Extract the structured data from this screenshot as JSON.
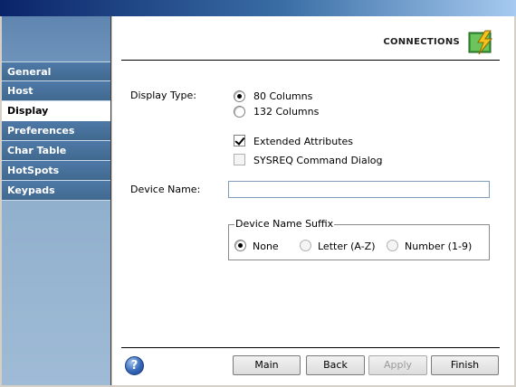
{
  "header": {
    "title": "CONNECTIONS",
    "icon": "connections-lightning-icon"
  },
  "sidebar": {
    "items": [
      {
        "label": "General"
      },
      {
        "label": "Host"
      },
      {
        "label": "Display"
      },
      {
        "label": "Preferences"
      },
      {
        "label": "Char Table"
      },
      {
        "label": "HotSpots"
      },
      {
        "label": "Keypads"
      }
    ],
    "active": "Display"
  },
  "display_type": {
    "label": "Display Type:",
    "options": [
      {
        "label": "80 Columns",
        "selected": true
      },
      {
        "label": "132 Columns",
        "selected": false
      }
    ]
  },
  "checkboxes": {
    "extended_attributes": {
      "label": "Extended Attributes",
      "checked": true
    },
    "sysreq_dialog": {
      "label": "SYSREQ Command Dialog",
      "checked": false
    }
  },
  "device_name": {
    "label": "Device Name:",
    "value": ""
  },
  "suffix": {
    "legend": "Device Name Suffix",
    "options": [
      {
        "label": "None",
        "selected": true
      },
      {
        "label": "Letter (A-Z)",
        "selected": false
      },
      {
        "label": "Number (1-9)",
        "selected": false
      }
    ]
  },
  "buttons": {
    "main": "Main",
    "back": "Back",
    "apply": "Apply",
    "finish": "Finish"
  },
  "colors": {
    "sidebar_blue": "#4e79a7",
    "title_gradient_start": "#0a246a",
    "title_gradient_end": "#a6caf0"
  }
}
